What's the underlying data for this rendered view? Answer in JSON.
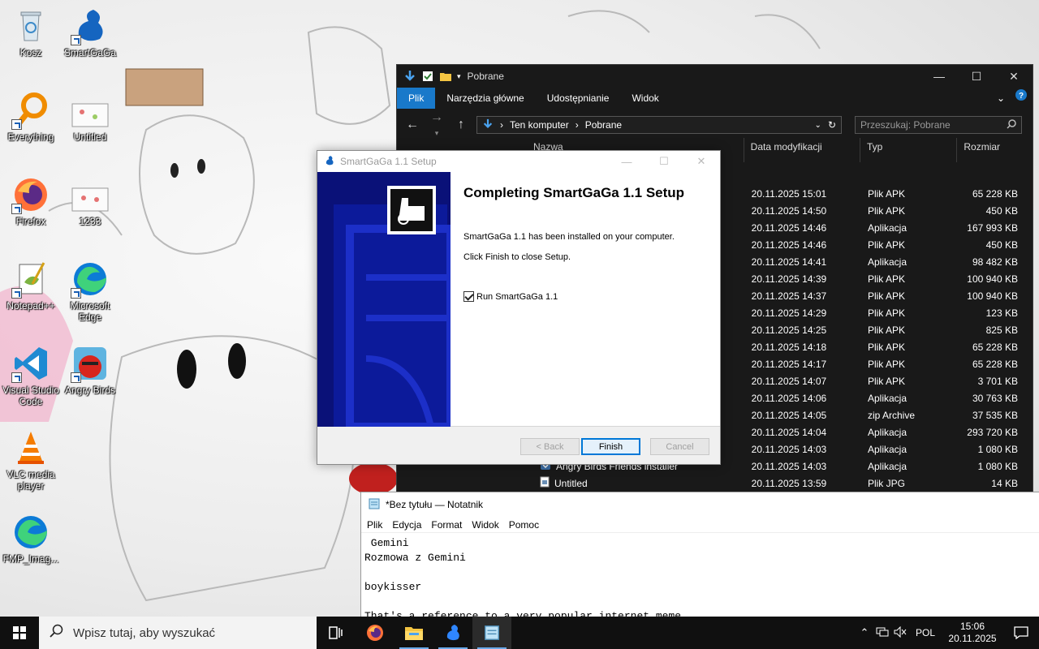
{
  "desktop": {
    "icons": [
      {
        "label": "Kosz"
      },
      {
        "label": "SmartGaGa"
      },
      {
        "label": "Everything"
      },
      {
        "label": "Untitled"
      },
      {
        "label": "Firefox"
      },
      {
        "label": "1233"
      },
      {
        "label": "Notepad++"
      },
      {
        "label": "Microsoft Edge"
      },
      {
        "label": "Visual Studio Code"
      },
      {
        "label": "Angry Birds"
      },
      {
        "label": "VLC media player"
      },
      {
        "label": "FMP_Imag..."
      }
    ]
  },
  "explorer": {
    "title": "Pobrane",
    "ribbon_tabs": [
      "Plik",
      "Narzędzia główne",
      "Udostępnianie",
      "Widok"
    ],
    "breadcrumb": [
      "Ten komputer",
      "Pobrane"
    ],
    "search_placeholder": "Przeszukaj: Pobrane",
    "columns": [
      "Nazwa",
      "Data modyfikacji",
      "Typ",
      "Rozmiar"
    ],
    "rows": [
      {
        "name": "",
        "date": "20.11.2025 15:01",
        "type": "Plik APK",
        "size": "65 228 KB"
      },
      {
        "name": "",
        "date": "20.11.2025 14:50",
        "type": "Plik APK",
        "size": "450 KB"
      },
      {
        "name": "",
        "date": "20.11.2025 14:46",
        "type": "Aplikacja",
        "size": "167 993 KB"
      },
      {
        "name": "",
        "date": "20.11.2025 14:46",
        "type": "Plik APK",
        "size": "450 KB"
      },
      {
        "name": "",
        "date": "20.11.2025 14:41",
        "type": "Aplikacja",
        "size": "98 482 KB"
      },
      {
        "name": "",
        "date": "20.11.2025 14:39",
        "type": "Plik APK",
        "size": "100 940 KB"
      },
      {
        "name": "",
        "date": "20.11.2025 14:37",
        "type": "Plik APK",
        "size": "100 940 KB"
      },
      {
        "name": "",
        "date": "20.11.2025 14:29",
        "type": "Plik APK",
        "size": "123 KB"
      },
      {
        "name": "",
        "date": "20.11.2025 14:25",
        "type": "Plik APK",
        "size": "825 KB"
      },
      {
        "name": "",
        "date": "20.11.2025 14:18",
        "type": "Plik APK",
        "size": "65 228 KB"
      },
      {
        "name": "",
        "date": "20.11.2025 14:17",
        "type": "Plik APK",
        "size": "65 228 KB"
      },
      {
        "name": "",
        "date": "20.11.2025 14:07",
        "type": "Plik APK",
        "size": "3 701 KB"
      },
      {
        "name": "",
        "date": "20.11.2025 14:06",
        "type": "Aplikacja",
        "size": "30 763 KB"
      },
      {
        "name": "",
        "date": "20.11.2025 14:05",
        "type": "zip Archive",
        "size": "37 535 KB"
      },
      {
        "name": "",
        "date": "20.11.2025 14:04",
        "type": "Aplikacja",
        "size": "293 720 KB"
      },
      {
        "name": "",
        "date": "20.11.2025 14:03",
        "type": "Aplikacja",
        "size": "1 080 KB"
      },
      {
        "name": "Angry Birds Friends installer",
        "date": "20.11.2025 14:03",
        "type": "Aplikacja",
        "size": "1 080 KB"
      },
      {
        "name": "Untitled",
        "date": "20.11.2025 13:59",
        "type": "Plik JPG",
        "size": "14 KB"
      }
    ]
  },
  "setup": {
    "title": "SmartGaGa 1.1 Setup",
    "heading": "Completing SmartGaGa 1.1 Setup",
    "message1": "SmartGaGa 1.1 has been installed on your computer.",
    "message2": "Click Finish to close Setup.",
    "run_label": "Run SmartGaGa 1.1",
    "run_checked": true,
    "back_label": "< Back",
    "finish_label": "Finish",
    "cancel_label": "Cancel"
  },
  "notepad": {
    "title": "*Bez tytułu — Notatnik",
    "menu": [
      "Plik",
      "Edycja",
      "Format",
      "Widok",
      "Pomoc"
    ],
    "text": " Gemini\nRozmowa z Gemini\n\nboykisser\n\nThat's a reference to a very popular internet meme."
  },
  "taskbar": {
    "search_placeholder": "Wpisz tutaj, aby wyszukać",
    "language": "POL",
    "time": "15:06",
    "date": "20.11.2025"
  },
  "colors": {
    "accent": "#1979ca",
    "explorer_bg": "#191919",
    "installer_banner": "#0a1178",
    "taskbar_bg": "#101010"
  }
}
